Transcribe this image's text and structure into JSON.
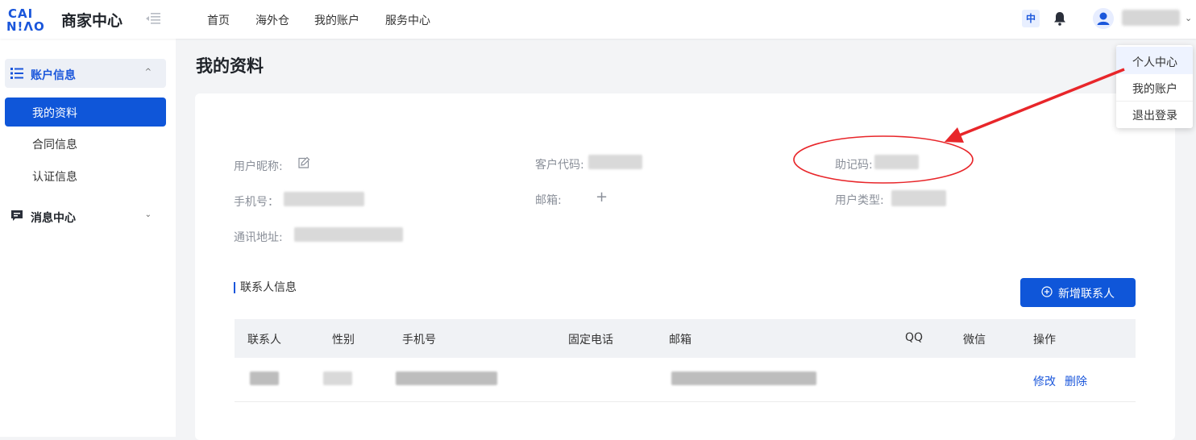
{
  "header": {
    "logo_line1": "CAI",
    "logo_line2": "N!ΛO",
    "brand": "商家中心",
    "nav": [
      "首页",
      "海外仓",
      "我的账户",
      "服务中心"
    ],
    "lang_badge": "中",
    "caret": "⌄"
  },
  "sidebar": {
    "group1": {
      "label": "账户信息",
      "chevron": "^"
    },
    "items": [
      "我的资料",
      "合同信息",
      "认证信息"
    ],
    "group2": {
      "label": "消息中心",
      "chevron": "⌄"
    }
  },
  "main": {
    "title": "我的资料",
    "profile": {
      "nickname_label": "用户昵称:",
      "customer_code_label": "客户代码:",
      "mnemonic_label": "助记码:",
      "phone_label": "手机号：",
      "email_label": "邮箱:",
      "email_add": "+",
      "user_type_label": "用户类型:",
      "address_label": "通讯地址:"
    },
    "contacts": {
      "title": "联系人信息",
      "add_button": "新增联系人",
      "columns": [
        "联系人",
        "性别",
        "手机号",
        "固定电话",
        "邮箱",
        "QQ",
        "微信",
        "操作"
      ],
      "row_actions": [
        "修改",
        "删除"
      ]
    }
  },
  "dropdown": {
    "items": [
      "个人中心",
      "我的账户",
      "退出登录"
    ]
  },
  "colors": {
    "primary": "#0f56d9",
    "annotation": "#e8262a"
  }
}
